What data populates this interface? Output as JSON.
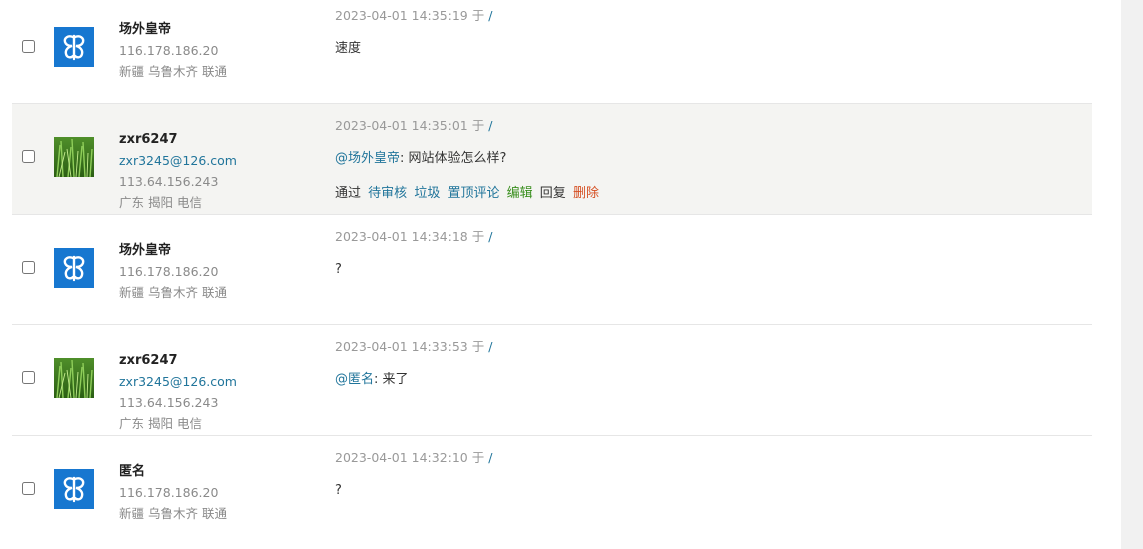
{
  "comments": [
    {
      "author": "场外皇帝",
      "ip": "116.178.186.20",
      "location": "新疆 乌鲁木齐 联通",
      "datetime": "2023-04-01 14:35:19",
      "at_label": "于",
      "path": "/",
      "content": "速度",
      "avatar": "butterfly-logo"
    },
    {
      "author": "zxr6247",
      "email": "zxr3245@126.com",
      "ip": "113.64.156.243",
      "location": "广东 揭阳 电信",
      "datetime": "2023-04-01 14:35:01",
      "at_label": "于",
      "path": "/",
      "mention": "@场外皇帝",
      "content": ": 网站体验怎么样?",
      "avatar": "grass-photo",
      "actions": {
        "approve": "通过",
        "pending": "待审核",
        "spam": "垃圾",
        "pin": "置顶评论",
        "edit": "编辑",
        "reply": "回复",
        "delete": "删除"
      }
    },
    {
      "author": "场外皇帝",
      "ip": "116.178.186.20",
      "location": "新疆 乌鲁木齐 联通",
      "datetime": "2023-04-01 14:34:18",
      "at_label": "于",
      "path": "/",
      "content": "?",
      "avatar": "butterfly-logo"
    },
    {
      "author": "zxr6247",
      "email": "zxr3245@126.com",
      "ip": "113.64.156.243",
      "location": "广东 揭阳 电信",
      "datetime": "2023-04-01 14:33:53",
      "at_label": "于",
      "path": "/",
      "mention": "@匿名",
      "content": ": 来了",
      "avatar": "grass-photo"
    },
    {
      "author": "匿名",
      "ip": "116.178.186.20",
      "location": "新疆 乌鲁木齐 联通",
      "datetime": "2023-04-01 14:32:10",
      "at_label": "于",
      "path": "/",
      "content": "?",
      "avatar": "butterfly-logo"
    }
  ],
  "colors": {
    "link": "#21759b",
    "edit": "#3a8f1f",
    "delete": "#d54e21",
    "highlight_row": "#f4f4f2",
    "avatar_blue": "#1777d0"
  }
}
